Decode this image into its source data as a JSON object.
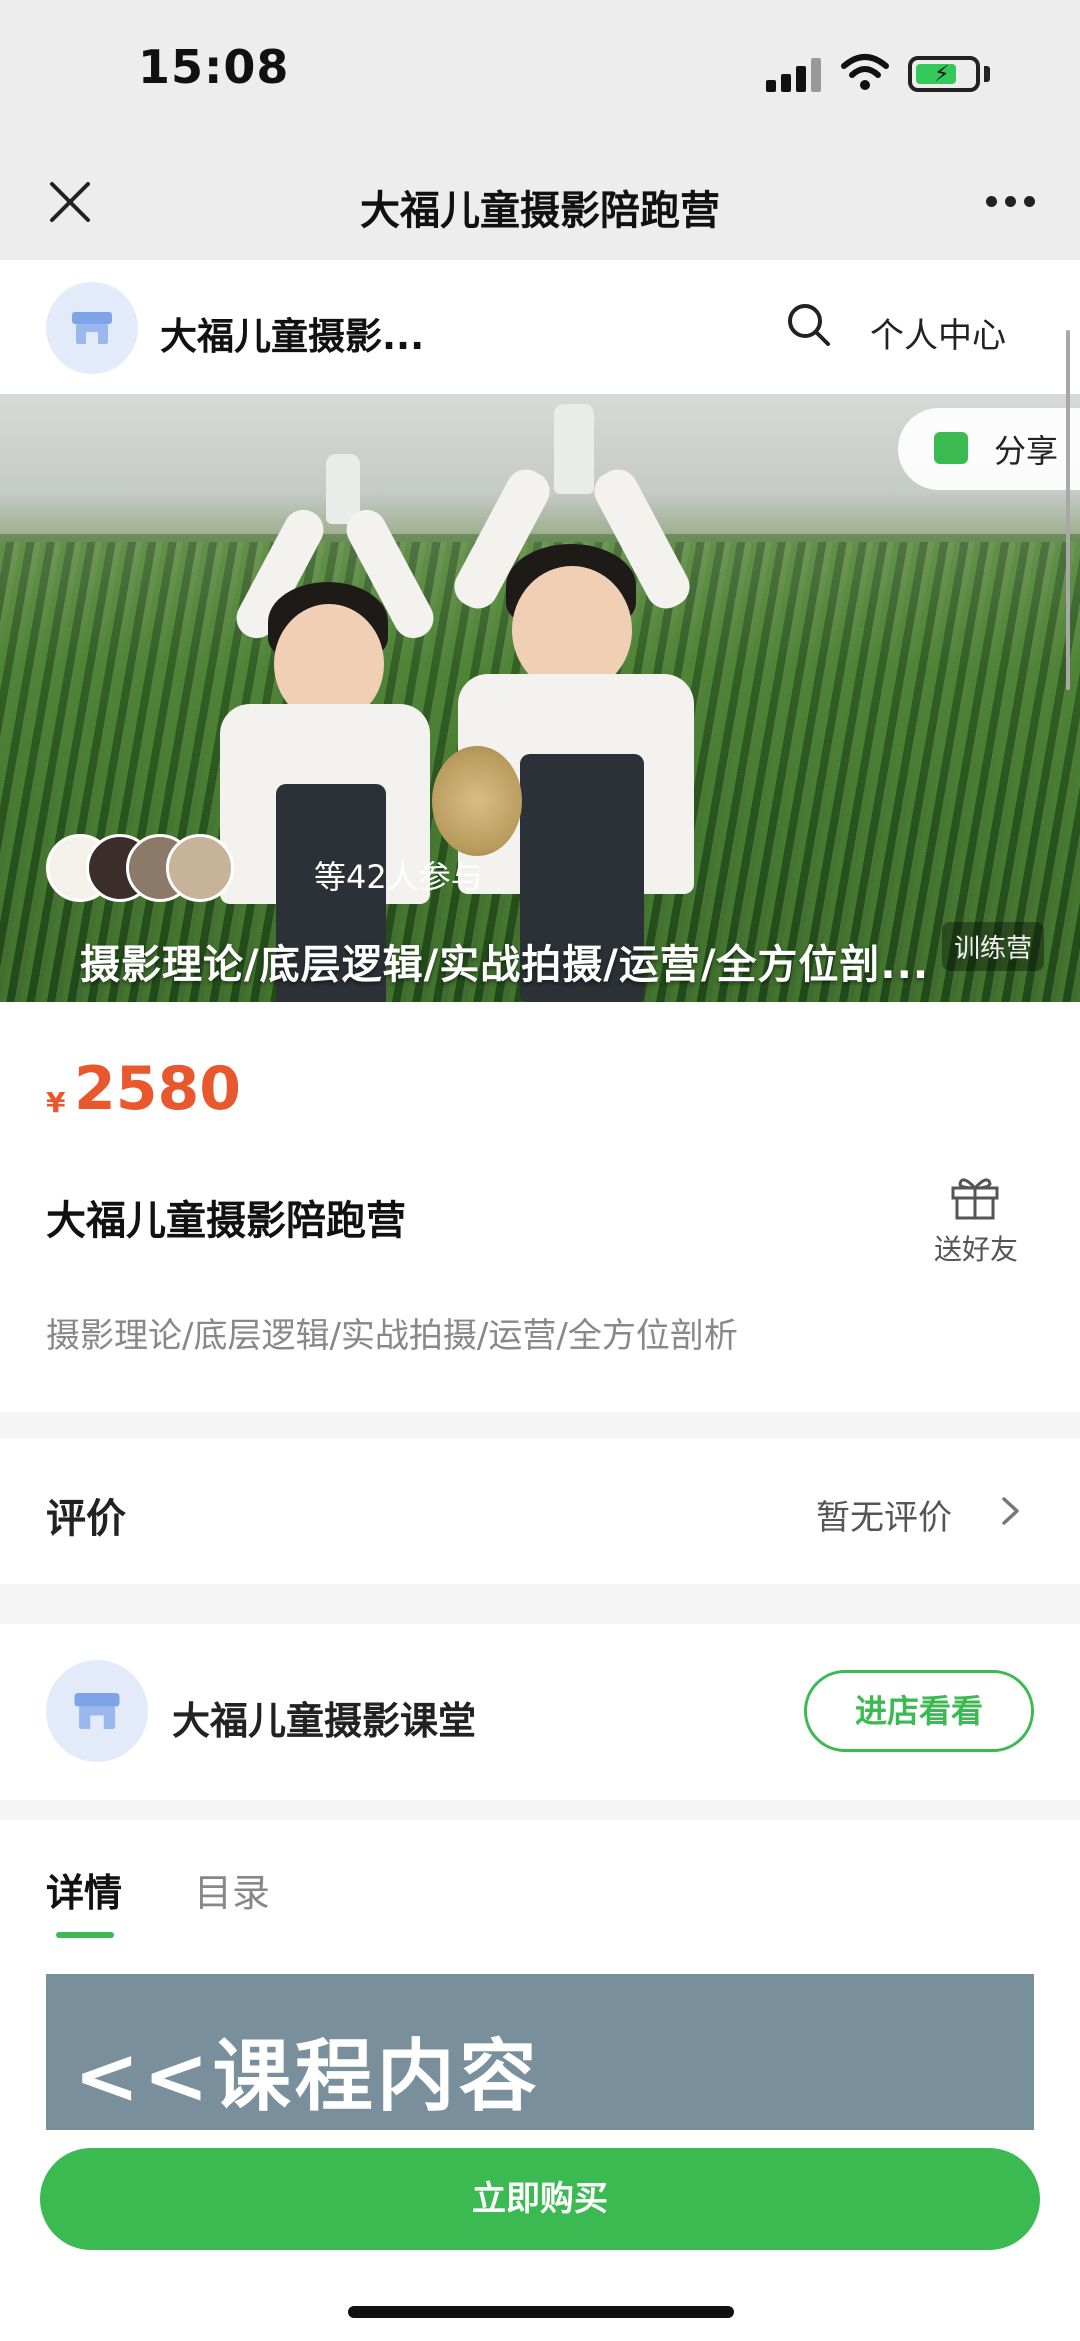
{
  "status_bar": {
    "time": "15:08"
  },
  "titlebar": {
    "title": "大福儿童摄影陪跑营",
    "close_icon": "close-icon",
    "more_icon": "more-dots-icon"
  },
  "shop_header": {
    "name": "大福儿童摄影...",
    "search_icon": "search-icon",
    "personal_center": "个人中心"
  },
  "banner": {
    "share_label": "分享",
    "participants": "等42人参与",
    "caption": "摄影理论/底层逻辑/实战拍摄/运营/全方位剖...",
    "tag": "训练营"
  },
  "product": {
    "currency": "¥",
    "price": "2580",
    "title": "大福儿童摄影陪跑营",
    "gift_label": "送好友",
    "subtitle": "摄影理论/底层逻辑/实战拍摄/运营/全方位剖析"
  },
  "reviews": {
    "label": "评价",
    "status": "暂无评价"
  },
  "store": {
    "name": "大福儿童摄影课堂",
    "visit_label": "进店看看"
  },
  "tabs": [
    {
      "label": "详情",
      "active": true
    },
    {
      "label": "目录",
      "active": false
    }
  ],
  "content": {
    "banner_text": "<<课程内容"
  },
  "bottom": {
    "buy_label": "立即购买"
  },
  "colors": {
    "accent_green": "#3cba52",
    "price_orange": "#e9572d"
  }
}
